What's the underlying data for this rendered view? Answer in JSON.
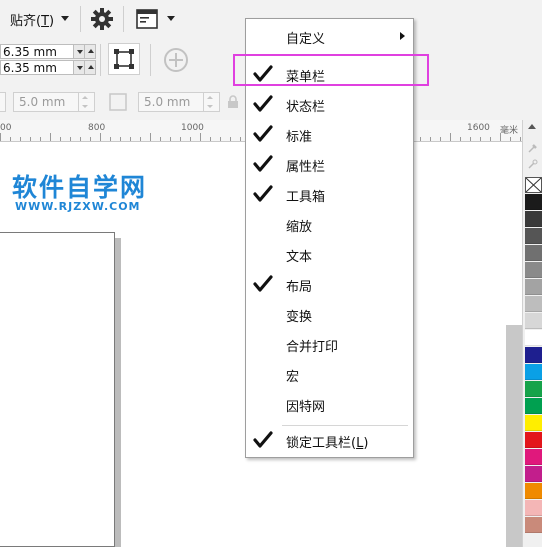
{
  "toolbar1": {
    "snap_label": "贴齐(",
    "snap_hotkey": "T",
    "snap_label_end": ")"
  },
  "toolbar2": {
    "nudge_x": "6.35 mm",
    "nudge_y": "6.35 mm"
  },
  "toolbar3": {
    "field1": "5.0 mm",
    "field2": "5.0 mm"
  },
  "ruler": {
    "labels": [
      "00",
      "800",
      "1000",
      "1600"
    ],
    "unit": "毫米"
  },
  "watermark": {
    "title": "软件自学网",
    "url": "WWW.RJZXW.COM"
  },
  "palette": {
    "colors": [
      "#1b1b1b",
      "#3a3a3a",
      "#555555",
      "#707070",
      "#8a8a8a",
      "#a3a3a3",
      "#bdbdbd",
      "#d7d7d7",
      "#ffffff",
      "#1e1f8f",
      "#0aa0e6",
      "#16a34a",
      "#00a050",
      "#ffee00",
      "#e3151b",
      "#e0187c",
      "#c21e8c",
      "#f08a00",
      "#f4b6b6",
      "#c98a7a"
    ]
  },
  "context_menu": {
    "customize": {
      "label": "自定义",
      "has_submenu": true
    },
    "items": [
      {
        "label": "菜单栏",
        "checked": true
      },
      {
        "label": "状态栏",
        "checked": true
      },
      {
        "label": "标准",
        "checked": true
      },
      {
        "label": "属性栏",
        "checked": true
      },
      {
        "label": "工具箱",
        "checked": true
      },
      {
        "label": "缩放",
        "checked": false
      },
      {
        "label": "文本",
        "checked": false
      },
      {
        "label": "布局",
        "checked": true
      },
      {
        "label": "变换",
        "checked": false
      },
      {
        "label": "合并打印",
        "checked": false
      },
      {
        "label": "宏",
        "checked": false
      },
      {
        "label": "因特网",
        "checked": false
      }
    ],
    "lock": {
      "label": "锁定工具栏(",
      "hotkey": "L",
      "label_end": ")",
      "checked": true
    },
    "highlight_color": "#e040e0"
  }
}
